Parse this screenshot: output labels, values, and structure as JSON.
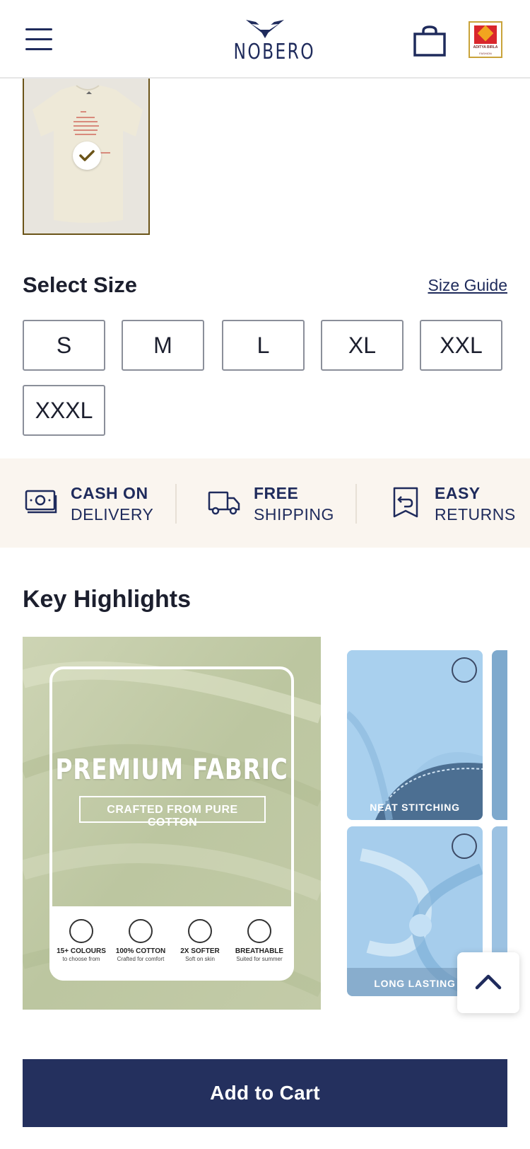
{
  "header": {
    "logo_text": "NOBERO",
    "brand_badge": {
      "name": "ADITYA BIRLA",
      "sub": "FASHION"
    }
  },
  "size": {
    "title": "Select Size",
    "guide_label": "Size Guide",
    "options": [
      "S",
      "M",
      "L",
      "XL",
      "XXL",
      "XXXL"
    ]
  },
  "perks": [
    {
      "line1": "CASH ON",
      "line2": "DELIVERY",
      "icon": "cash-icon"
    },
    {
      "line1": "FREE",
      "line2": "SHIPPING",
      "icon": "truck-icon"
    },
    {
      "line1": "EASY",
      "line2": "RETURNS",
      "icon": "returns-icon"
    }
  ],
  "highlights": {
    "title": "Key Highlights",
    "main": {
      "title": "PREMIUM FABRIC",
      "subtitle": "CRAFTED FROM PURE COTTON",
      "features": [
        {
          "title": "15+ COLOURS",
          "sub": "to choose from"
        },
        {
          "title": "100% COTTON",
          "sub": "Crafted for comfort"
        },
        {
          "title": "2X SOFTER",
          "sub": "Soft on skin"
        },
        {
          "title": "BREATHABLE",
          "sub": "Suited for summer"
        }
      ]
    },
    "cards": [
      {
        "caption": "NEAT STITCHING"
      },
      {
        "caption": "LONG LASTING"
      }
    ]
  },
  "cta": {
    "add_to_cart": "Add to Cart"
  },
  "colors": {
    "navy": "#24305e",
    "perk_bg": "#faf5ef",
    "swatch_border": "#6b5418"
  }
}
